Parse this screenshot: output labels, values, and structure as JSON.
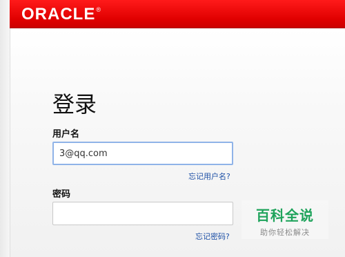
{
  "header": {
    "logo_text": "ORACLE",
    "logo_mark": "®",
    "brand_color": "#e00000"
  },
  "login": {
    "title": "登录",
    "username_label": "用户名",
    "username_value": "3@qq.com",
    "forgot_username": "忘记用户名?",
    "password_label": "密码",
    "password_value": "",
    "forgot_password": "忘记密码?"
  },
  "watermark": {
    "title": "百科全说",
    "subtitle": "助你轻松解决"
  }
}
